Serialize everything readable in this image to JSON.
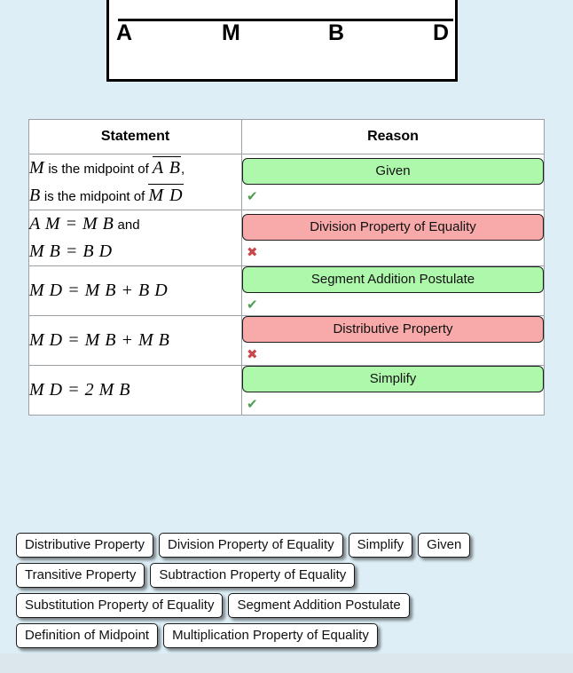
{
  "colors": {
    "page_background": "#ddeef6",
    "correct_chip": "#aef8ac",
    "incorrect_chip": "#f8a9a9",
    "check_mark": "#4f9c52",
    "cross_mark": "#c9474a",
    "chip_border": "#1b1b1b"
  },
  "figure": {
    "points": [
      {
        "label": "A"
      },
      {
        "label": "M"
      },
      {
        "label": "B"
      },
      {
        "label": "D"
      }
    ]
  },
  "table": {
    "headers": {
      "statement": "Statement",
      "reason": "Reason"
    },
    "rows": [
      {
        "statement": {
          "lines": [
            {
              "var": "M",
              "text": " is the midpoint of ",
              "segment": "A B",
              "tail": ","
            },
            {
              "var": "B",
              "text": " is the midpoint of ",
              "segment": "M D",
              "tail": ""
            }
          ]
        },
        "reason": {
          "label": "Given",
          "state": "correct",
          "mark": "✔"
        }
      },
      {
        "statement": {
          "lines": [
            {
              "expr": "A M = M B",
              "text": " and"
            },
            {
              "expr": "M B = B D",
              "text": ""
            }
          ]
        },
        "reason": {
          "label": "Division Property of Equality",
          "state": "incorrect",
          "mark": "✖"
        }
      },
      {
        "statement": {
          "lines": [
            {
              "expr": "M D = M B + B D",
              "text": ""
            }
          ]
        },
        "reason": {
          "label": "Segment Addition Postulate",
          "state": "correct",
          "mark": "✔"
        }
      },
      {
        "statement": {
          "lines": [
            {
              "expr": "M D = M B + M B",
              "text": ""
            }
          ]
        },
        "reason": {
          "label": "Distributive Property",
          "state": "incorrect",
          "mark": "✖"
        }
      },
      {
        "statement": {
          "lines": [
            {
              "expr": "M D = 2 M B",
              "text": ""
            }
          ]
        },
        "reason": {
          "label": "Simplify",
          "state": "correct",
          "mark": "✔"
        }
      }
    ]
  },
  "answer_bank": {
    "rows": [
      [
        {
          "label": "Distributive Property"
        },
        {
          "label": "Division Property of Equality"
        },
        {
          "label": "Simplify"
        },
        {
          "label": "Given"
        }
      ],
      [
        {
          "label": "Transitive Property"
        },
        {
          "label": "Subtraction Property of Equality"
        }
      ],
      [
        {
          "label": "Substitution Property of Equality"
        },
        {
          "label": "Segment Addition Postulate"
        }
      ],
      [
        {
          "label": "Definition of Midpoint"
        },
        {
          "label": "Multiplication Property of Equality"
        }
      ]
    ]
  }
}
